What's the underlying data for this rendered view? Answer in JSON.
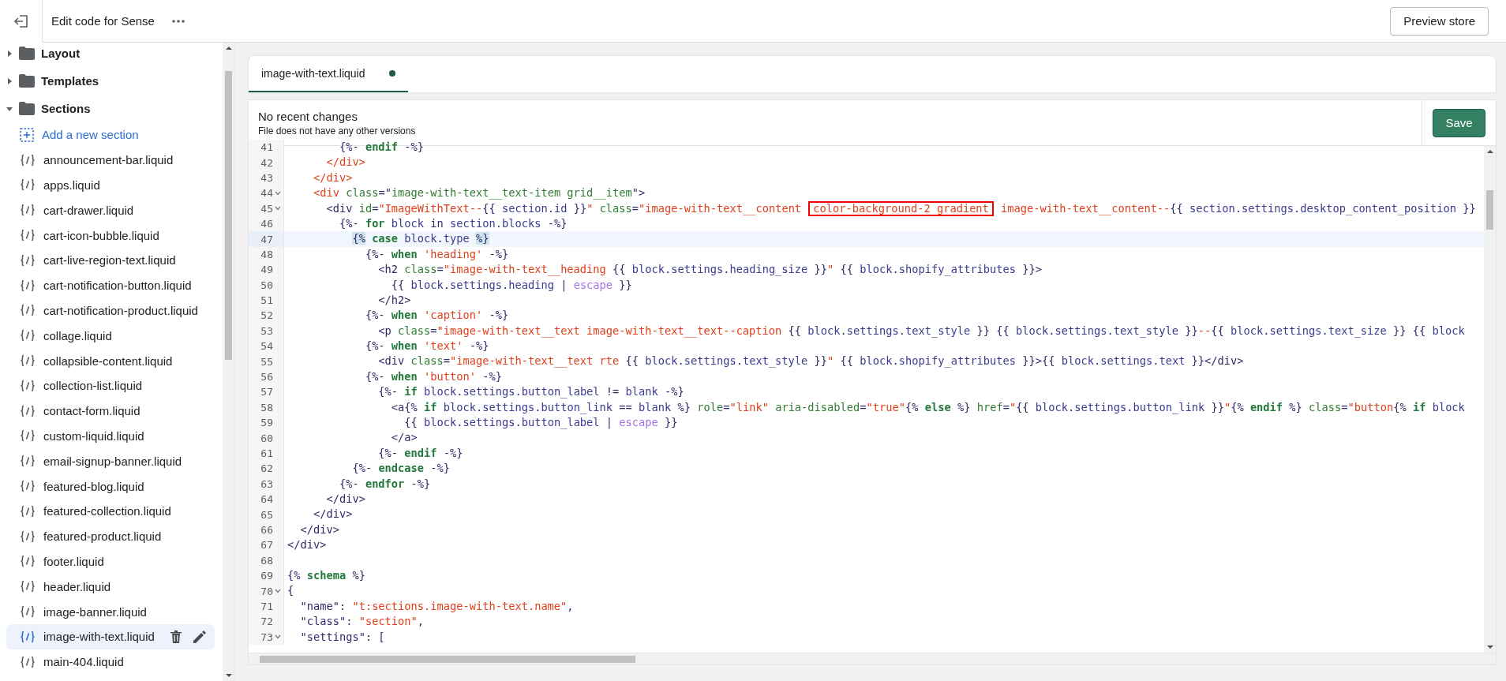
{
  "header": {
    "title": "Edit code for Sense",
    "preview_button": "Preview store"
  },
  "sidebar": {
    "folders": [
      {
        "name": "Layout",
        "expanded": false
      },
      {
        "name": "Templates",
        "expanded": false
      },
      {
        "name": "Sections",
        "expanded": true,
        "add_label": "Add a new section",
        "files": [
          {
            "name": "announcement-bar.liquid",
            "selected": false
          },
          {
            "name": "apps.liquid",
            "selected": false
          },
          {
            "name": "cart-drawer.liquid",
            "selected": false
          },
          {
            "name": "cart-icon-bubble.liquid",
            "selected": false
          },
          {
            "name": "cart-live-region-text.liquid",
            "selected": false
          },
          {
            "name": "cart-notification-button.liquid",
            "selected": false
          },
          {
            "name": "cart-notification-product.liquid",
            "selected": false
          },
          {
            "name": "collage.liquid",
            "selected": false
          },
          {
            "name": "collapsible-content.liquid",
            "selected": false
          },
          {
            "name": "collection-list.liquid",
            "selected": false
          },
          {
            "name": "contact-form.liquid",
            "selected": false
          },
          {
            "name": "custom-liquid.liquid",
            "selected": false
          },
          {
            "name": "email-signup-banner.liquid",
            "selected": false
          },
          {
            "name": "featured-blog.liquid",
            "selected": false
          },
          {
            "name": "featured-collection.liquid",
            "selected": false
          },
          {
            "name": "featured-product.liquid",
            "selected": false
          },
          {
            "name": "footer.liquid",
            "selected": false
          },
          {
            "name": "header.liquid",
            "selected": false
          },
          {
            "name": "image-banner.liquid",
            "selected": false
          },
          {
            "name": "image-with-text.liquid",
            "selected": true
          },
          {
            "name": "main-404.liquid",
            "selected": false
          }
        ]
      }
    ]
  },
  "tabs": [
    {
      "label": "image-with-text.liquid",
      "selected": true,
      "unsaved": true
    }
  ],
  "status": {
    "title": "No recent changes",
    "subtitle": "File does not have any other versions"
  },
  "save_button": "Save",
  "code": {
    "lines": [
      {
        "n": "41",
        "fold": false,
        "active": false,
        "tokens": [
          {
            "kind": "p",
            "text": "        {%- "
          },
          {
            "kind": "k",
            "text": "endif"
          },
          {
            "kind": "p",
            "text": " -%}"
          }
        ]
      },
      {
        "n": "42",
        "fold": false,
        "active": false,
        "tokens": [
          {
            "kind": "tag",
            "text": "      </div>"
          }
        ]
      },
      {
        "n": "43",
        "fold": false,
        "active": false,
        "tokens": [
          {
            "kind": "tag",
            "text": "    </div>"
          }
        ]
      },
      {
        "n": "44",
        "fold": true,
        "active": false,
        "tokens": [
          {
            "kind": "tag",
            "text": "    <div"
          },
          {
            "kind": "a",
            "text": " class"
          },
          {
            "kind": "p",
            "text": "=\""
          },
          {
            "kind": "a",
            "text": "image-with-text__text-item grid__item"
          },
          {
            "kind": "p",
            "text": "\">"
          }
        ]
      },
      {
        "n": "45",
        "fold": true,
        "active": false,
        "tokens": [
          {
            "kind": "p",
            "text": "      <div"
          },
          {
            "kind": "a",
            "text": " id"
          },
          {
            "kind": "p",
            "text": "="
          },
          {
            "kind": "s",
            "text": "\"ImageWithText--"
          },
          {
            "kind": "p",
            "text": "{{ "
          },
          {
            "kind": "v",
            "text": "section"
          },
          {
            "kind": "p",
            "text": "."
          },
          {
            "kind": "v",
            "text": "id"
          },
          {
            "kind": "p",
            "text": " }}"
          },
          {
            "kind": "s",
            "text": "\""
          },
          {
            "kind": "a",
            "text": " class"
          },
          {
            "kind": "p",
            "text": "="
          },
          {
            "kind": "s",
            "text": "\"image-with-text__content "
          },
          {
            "kind": "box",
            "text": "color-background-2 gradient"
          },
          {
            "kind": "s",
            "text": " image-with-text__content--"
          },
          {
            "kind": "p",
            "text": "{{ "
          },
          {
            "kind": "v",
            "text": "section"
          },
          {
            "kind": "p",
            "text": "."
          },
          {
            "kind": "v",
            "text": "settings"
          },
          {
            "kind": "p",
            "text": "."
          },
          {
            "kind": "v",
            "text": "desktop_content_position"
          },
          {
            "kind": "p",
            "text": " }}"
          }
        ]
      },
      {
        "n": "46",
        "fold": false,
        "active": false,
        "tokens": [
          {
            "kind": "p",
            "text": "        {%- "
          },
          {
            "kind": "k",
            "text": "for"
          },
          {
            "kind": "v",
            "text": " block"
          },
          {
            "kind": "p",
            "text": " in "
          },
          {
            "kind": "v",
            "text": "section.blocks"
          },
          {
            "kind": "p",
            "text": " -%}"
          }
        ]
      },
      {
        "n": "47",
        "fold": false,
        "active": true,
        "tokens": [
          {
            "kind": "match",
            "text": "          {%"
          },
          {
            "kind": "k",
            "text": " case"
          },
          {
            "kind": "v",
            "text": " block"
          },
          {
            "kind": "p",
            "text": "."
          },
          {
            "kind": "v",
            "text": "type"
          },
          {
            "kind": "match",
            "text": " %}"
          }
        ]
      },
      {
        "n": "48",
        "fold": false,
        "active": false,
        "tokens": [
          {
            "kind": "p",
            "text": "            {%- "
          },
          {
            "kind": "k",
            "text": "when"
          },
          {
            "kind": "s",
            "text": " 'heading'"
          },
          {
            "kind": "p",
            "text": " -%}"
          }
        ]
      },
      {
        "n": "49",
        "fold": false,
        "active": false,
        "tokens": [
          {
            "kind": "p",
            "text": "              <h2"
          },
          {
            "kind": "a",
            "text": " class"
          },
          {
            "kind": "p",
            "text": "="
          },
          {
            "kind": "s",
            "text": "\"image-with-text__heading "
          },
          {
            "kind": "p",
            "text": "{{ "
          },
          {
            "kind": "v",
            "text": "block"
          },
          {
            "kind": "p",
            "text": "."
          },
          {
            "kind": "v",
            "text": "settings"
          },
          {
            "kind": "p",
            "text": "."
          },
          {
            "kind": "v",
            "text": "heading_size"
          },
          {
            "kind": "p",
            "text": " }}"
          },
          {
            "kind": "s",
            "text": "\""
          },
          {
            "kind": "p",
            "text": " {{ "
          },
          {
            "kind": "v",
            "text": "block"
          },
          {
            "kind": "p",
            "text": "."
          },
          {
            "kind": "v",
            "text": "shopify_attributes"
          },
          {
            "kind": "p",
            "text": " }}>"
          }
        ]
      },
      {
        "n": "50",
        "fold": false,
        "active": false,
        "tokens": [
          {
            "kind": "p",
            "text": "                {{ "
          },
          {
            "kind": "v",
            "text": "block"
          },
          {
            "kind": "p",
            "text": "."
          },
          {
            "kind": "v",
            "text": "settings"
          },
          {
            "kind": "p",
            "text": "."
          },
          {
            "kind": "v",
            "text": "heading"
          },
          {
            "kind": "p",
            "text": " | "
          },
          {
            "kind": "f",
            "text": "escape"
          },
          {
            "kind": "p",
            "text": " }}"
          }
        ]
      },
      {
        "n": "51",
        "fold": false,
        "active": false,
        "tokens": [
          {
            "kind": "p",
            "text": "              </h2>"
          }
        ]
      },
      {
        "n": "52",
        "fold": false,
        "active": false,
        "tokens": [
          {
            "kind": "p",
            "text": "            {%- "
          },
          {
            "kind": "k",
            "text": "when"
          },
          {
            "kind": "s",
            "text": " 'caption'"
          },
          {
            "kind": "p",
            "text": " -%}"
          }
        ]
      },
      {
        "n": "53",
        "fold": false,
        "active": false,
        "tokens": [
          {
            "kind": "p",
            "text": "              <p"
          },
          {
            "kind": "a",
            "text": " class"
          },
          {
            "kind": "p",
            "text": "="
          },
          {
            "kind": "s",
            "text": "\"image-with-text__text image-with-text__text--caption "
          },
          {
            "kind": "p",
            "text": "{{ "
          },
          {
            "kind": "v",
            "text": "block"
          },
          {
            "kind": "p",
            "text": "."
          },
          {
            "kind": "v",
            "text": "settings"
          },
          {
            "kind": "p",
            "text": "."
          },
          {
            "kind": "v",
            "text": "text_style"
          },
          {
            "kind": "p",
            "text": " }} {{ "
          },
          {
            "kind": "v",
            "text": "block"
          },
          {
            "kind": "p",
            "text": "."
          },
          {
            "kind": "v",
            "text": "settings"
          },
          {
            "kind": "p",
            "text": "."
          },
          {
            "kind": "v",
            "text": "text_style"
          },
          {
            "kind": "p",
            "text": " }}"
          },
          {
            "kind": "s",
            "text": "--"
          },
          {
            "kind": "p",
            "text": "{{ "
          },
          {
            "kind": "v",
            "text": "block"
          },
          {
            "kind": "p",
            "text": "."
          },
          {
            "kind": "v",
            "text": "settings"
          },
          {
            "kind": "p",
            "text": "."
          },
          {
            "kind": "v",
            "text": "text_size"
          },
          {
            "kind": "p",
            "text": " }} {{ "
          },
          {
            "kind": "v",
            "text": "block"
          }
        ]
      },
      {
        "n": "54",
        "fold": false,
        "active": false,
        "tokens": [
          {
            "kind": "p",
            "text": "            {%- "
          },
          {
            "kind": "k",
            "text": "when"
          },
          {
            "kind": "s",
            "text": " 'text'"
          },
          {
            "kind": "p",
            "text": " -%}"
          }
        ]
      },
      {
        "n": "55",
        "fold": false,
        "active": false,
        "tokens": [
          {
            "kind": "p",
            "text": "              <div"
          },
          {
            "kind": "a",
            "text": " class"
          },
          {
            "kind": "p",
            "text": "="
          },
          {
            "kind": "s",
            "text": "\"image-with-text__text rte "
          },
          {
            "kind": "p",
            "text": "{{ "
          },
          {
            "kind": "v",
            "text": "block"
          },
          {
            "kind": "p",
            "text": "."
          },
          {
            "kind": "v",
            "text": "settings"
          },
          {
            "kind": "p",
            "text": "."
          },
          {
            "kind": "v",
            "text": "text_style"
          },
          {
            "kind": "p",
            "text": " }}"
          },
          {
            "kind": "s",
            "text": "\""
          },
          {
            "kind": "p",
            "text": " {{ "
          },
          {
            "kind": "v",
            "text": "block"
          },
          {
            "kind": "p",
            "text": "."
          },
          {
            "kind": "v",
            "text": "shopify_attributes"
          },
          {
            "kind": "p",
            "text": " }}>{{ "
          },
          {
            "kind": "v",
            "text": "block"
          },
          {
            "kind": "p",
            "text": "."
          },
          {
            "kind": "v",
            "text": "settings"
          },
          {
            "kind": "p",
            "text": "."
          },
          {
            "kind": "v",
            "text": "text"
          },
          {
            "kind": "p",
            "text": " }}</div>"
          }
        ]
      },
      {
        "n": "56",
        "fold": false,
        "active": false,
        "tokens": [
          {
            "kind": "p",
            "text": "            {%- "
          },
          {
            "kind": "k",
            "text": "when"
          },
          {
            "kind": "s",
            "text": " 'button'"
          },
          {
            "kind": "p",
            "text": " -%}"
          }
        ]
      },
      {
        "n": "57",
        "fold": false,
        "active": false,
        "tokens": [
          {
            "kind": "p",
            "text": "              {%- "
          },
          {
            "kind": "k",
            "text": "if"
          },
          {
            "kind": "v",
            "text": " block"
          },
          {
            "kind": "p",
            "text": "."
          },
          {
            "kind": "v",
            "text": "settings"
          },
          {
            "kind": "p",
            "text": "."
          },
          {
            "kind": "v",
            "text": "button_label"
          },
          {
            "kind": "p",
            "text": " != "
          },
          {
            "kind": "v",
            "text": "blank"
          },
          {
            "kind": "p",
            "text": " -%}"
          }
        ]
      },
      {
        "n": "58",
        "fold": false,
        "active": false,
        "tokens": [
          {
            "kind": "p",
            "text": "                <a{% "
          },
          {
            "kind": "k",
            "text": "if"
          },
          {
            "kind": "v",
            "text": " block"
          },
          {
            "kind": "p",
            "text": "."
          },
          {
            "kind": "v",
            "text": "settings"
          },
          {
            "kind": "p",
            "text": "."
          },
          {
            "kind": "v",
            "text": "button_link"
          },
          {
            "kind": "p",
            "text": " == "
          },
          {
            "kind": "v",
            "text": "blank"
          },
          {
            "kind": "p",
            "text": " %} "
          },
          {
            "kind": "a",
            "text": "role"
          },
          {
            "kind": "p",
            "text": "="
          },
          {
            "kind": "s",
            "text": "\"link\""
          },
          {
            "kind": "a",
            "text": " aria-disabled"
          },
          {
            "kind": "p",
            "text": "="
          },
          {
            "kind": "s",
            "text": "\"true\""
          },
          {
            "kind": "p",
            "text": "{% "
          },
          {
            "kind": "k",
            "text": "else"
          },
          {
            "kind": "p",
            "text": " %} "
          },
          {
            "kind": "a",
            "text": "href"
          },
          {
            "kind": "p",
            "text": "="
          },
          {
            "kind": "s",
            "text": "\""
          },
          {
            "kind": "p",
            "text": "{{ "
          },
          {
            "kind": "v",
            "text": "block"
          },
          {
            "kind": "p",
            "text": "."
          },
          {
            "kind": "v",
            "text": "settings"
          },
          {
            "kind": "p",
            "text": "."
          },
          {
            "kind": "v",
            "text": "button_link"
          },
          {
            "kind": "p",
            "text": " }}"
          },
          {
            "kind": "s",
            "text": "\""
          },
          {
            "kind": "p",
            "text": "{% "
          },
          {
            "kind": "k",
            "text": "endif"
          },
          {
            "kind": "p",
            "text": " %} "
          },
          {
            "kind": "a",
            "text": "class"
          },
          {
            "kind": "p",
            "text": "="
          },
          {
            "kind": "s",
            "text": "\"button"
          },
          {
            "kind": "p",
            "text": "{% "
          },
          {
            "kind": "k",
            "text": "if"
          },
          {
            "kind": "v",
            "text": " block"
          }
        ]
      },
      {
        "n": "59",
        "fold": false,
        "active": false,
        "tokens": [
          {
            "kind": "p",
            "text": "                  {{ "
          },
          {
            "kind": "v",
            "text": "block"
          },
          {
            "kind": "p",
            "text": "."
          },
          {
            "kind": "v",
            "text": "settings"
          },
          {
            "kind": "p",
            "text": "."
          },
          {
            "kind": "v",
            "text": "button_label"
          },
          {
            "kind": "p",
            "text": " | "
          },
          {
            "kind": "f",
            "text": "escape"
          },
          {
            "kind": "p",
            "text": " }}"
          }
        ]
      },
      {
        "n": "60",
        "fold": false,
        "active": false,
        "tokens": [
          {
            "kind": "p",
            "text": "                </a>"
          }
        ]
      },
      {
        "n": "61",
        "fold": false,
        "active": false,
        "tokens": [
          {
            "kind": "p",
            "text": "              {%- "
          },
          {
            "kind": "k",
            "text": "endif"
          },
          {
            "kind": "p",
            "text": " -%}"
          }
        ]
      },
      {
        "n": "62",
        "fold": false,
        "active": false,
        "tokens": [
          {
            "kind": "p",
            "text": "          {%- "
          },
          {
            "kind": "k",
            "text": "endcase"
          },
          {
            "kind": "p",
            "text": " -%}"
          }
        ]
      },
      {
        "n": "63",
        "fold": false,
        "active": false,
        "tokens": [
          {
            "kind": "p",
            "text": "        {%- "
          },
          {
            "kind": "k",
            "text": "endfor"
          },
          {
            "kind": "p",
            "text": " -%}"
          }
        ]
      },
      {
        "n": "64",
        "fold": false,
        "active": false,
        "tokens": [
          {
            "kind": "p",
            "text": "      </div>"
          }
        ]
      },
      {
        "n": "65",
        "fold": false,
        "active": false,
        "tokens": [
          {
            "kind": "p",
            "text": "    </div>"
          }
        ]
      },
      {
        "n": "66",
        "fold": false,
        "active": false,
        "tokens": [
          {
            "kind": "p",
            "text": "  </div>"
          }
        ]
      },
      {
        "n": "67",
        "fold": false,
        "active": false,
        "tokens": [
          {
            "kind": "p",
            "text": "</div>"
          }
        ]
      },
      {
        "n": "68",
        "fold": false,
        "active": false
      },
      {
        "n": "69",
        "fold": false,
        "active": false,
        "tokens": [
          {
            "kind": "p",
            "text": "{% "
          },
          {
            "kind": "k",
            "text": "schema"
          },
          {
            "kind": "p",
            "text": " %}"
          }
        ]
      },
      {
        "n": "70",
        "fold": true,
        "active": false,
        "tokens": [
          {
            "kind": "p",
            "text": "{"
          }
        ]
      },
      {
        "n": "71",
        "fold": false,
        "active": false,
        "tokens": [
          {
            "kind": "p",
            "text": "  \"name\": "
          },
          {
            "kind": "s",
            "text": "\"t:sections.image-with-text.name\""
          },
          {
            "kind": "p",
            "text": ","
          }
        ]
      },
      {
        "n": "72",
        "fold": false,
        "active": false,
        "tokens": [
          {
            "kind": "p",
            "text": "  \"class\": "
          },
          {
            "kind": "s",
            "text": "\"section\""
          },
          {
            "kind": "p",
            "text": ","
          }
        ]
      },
      {
        "n": "73",
        "fold": true,
        "active": false,
        "tokens": [
          {
            "kind": "p",
            "text": "  \"settings\": ["
          }
        ]
      }
    ]
  }
}
